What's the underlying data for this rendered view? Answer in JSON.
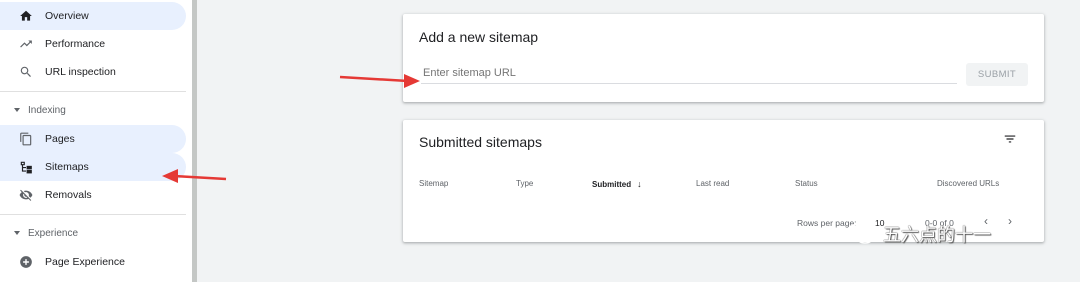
{
  "sidebar": {
    "items_top": [
      {
        "label": "Overview",
        "icon": "home-icon"
      },
      {
        "label": "Performance",
        "icon": "trending-up-icon"
      },
      {
        "label": "URL inspection",
        "icon": "search-icon"
      }
    ],
    "section_indexing": "Indexing",
    "items_indexing": [
      {
        "label": "Pages",
        "icon": "pages-icon"
      },
      {
        "label": "Sitemaps",
        "icon": "sitemap-icon"
      },
      {
        "label": "Removals",
        "icon": "removals-icon"
      }
    ],
    "section_experience": "Experience",
    "items_experience": [
      {
        "label": "Page Experience",
        "icon": "add-circle-icon"
      }
    ]
  },
  "add_sitemap": {
    "title": "Add a new sitemap",
    "placeholder": "Enter sitemap URL",
    "submit_label": "SUBMIT"
  },
  "submitted_sitemaps": {
    "title": "Submitted sitemaps",
    "columns": [
      "Sitemap",
      "Type",
      "Submitted",
      "Last read",
      "Status",
      "Discovered URLs"
    ],
    "sorted_column": "Submitted",
    "rows_per_page_label": "Rows per page:",
    "rows_per_page_value": "10",
    "range_text": "0-0 of 0"
  },
  "watermark": {
    "text": "五六点的十一"
  },
  "colors": {
    "accent": "#1a73e8",
    "active_bg": "#e8f0fe",
    "arrow": "#e53935"
  }
}
